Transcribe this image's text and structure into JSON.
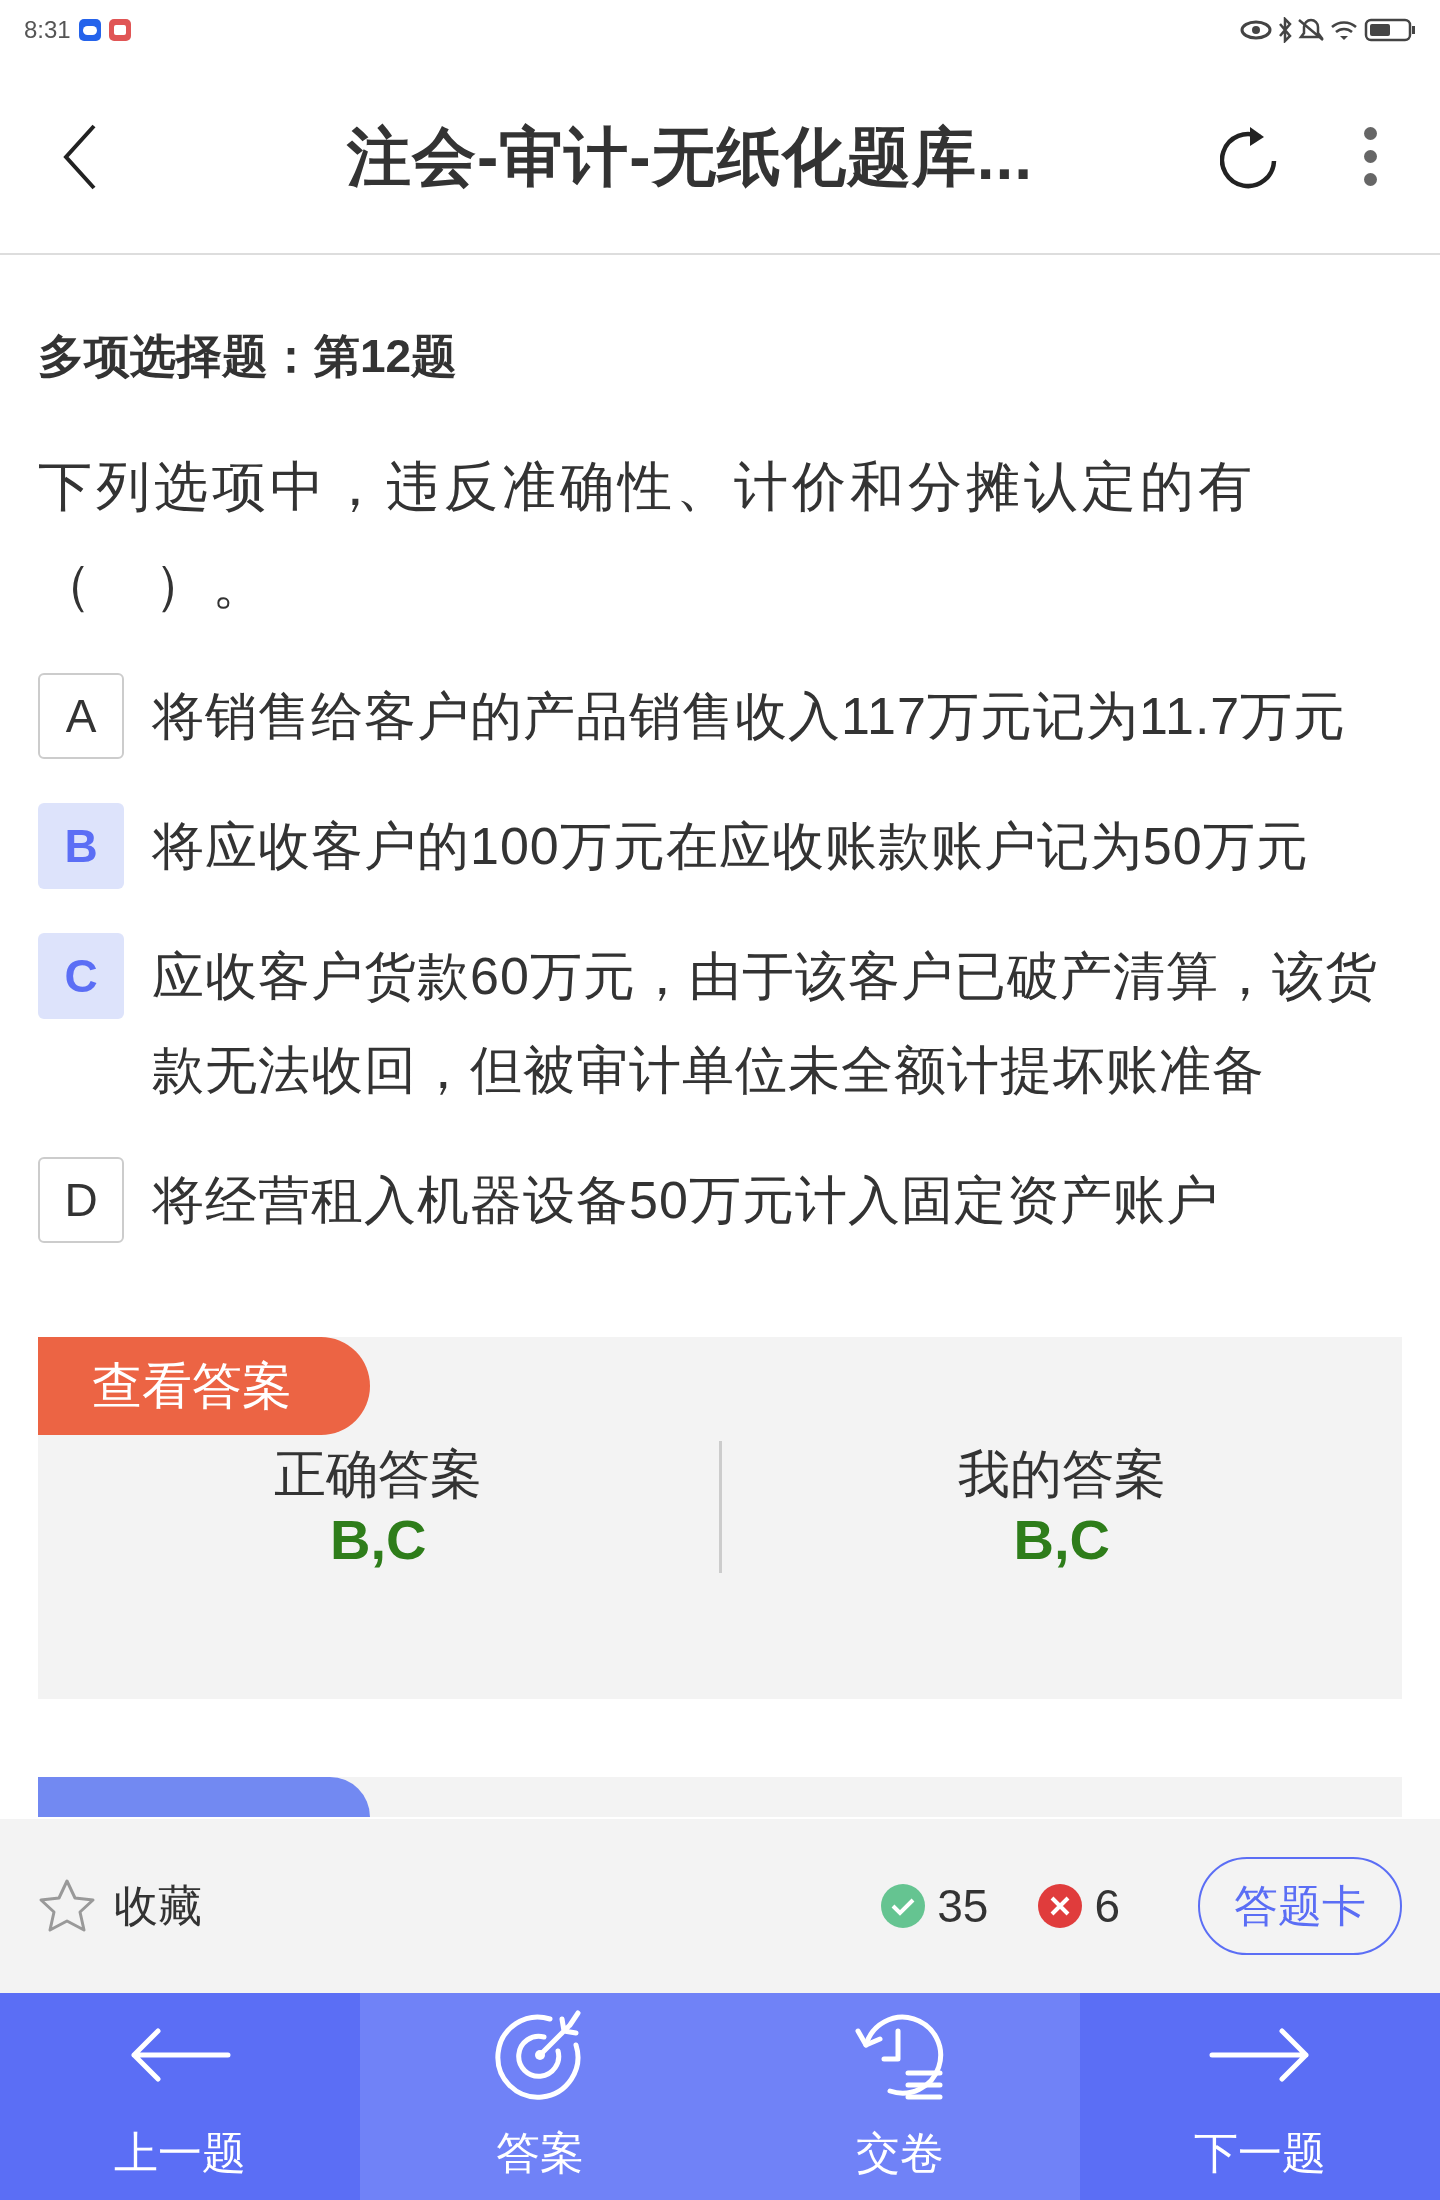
{
  "status_bar": {
    "time": "8:31"
  },
  "header": {
    "title": "注会-审计-无纸化题库..."
  },
  "question": {
    "type_label": "多项选择题：第12题",
    "text": "下列选项中，违反准确性、计价和分摊认定的有（　）。",
    "options": [
      {
        "letter": "A",
        "text": "将销售给客户的产品销售收入117万元记为11.7万元",
        "selected": false
      },
      {
        "letter": "B",
        "text": "将应收客户的100万元在应收账款账户记为50万元",
        "selected": true
      },
      {
        "letter": "C",
        "text": "应收客户货款60万元，由于该客户已破产清算，该货款无法收回，但被审计单位未全额计提坏账准备",
        "selected": true
      },
      {
        "letter": "D",
        "text": "将经营租入机器设备50万元计入固定资产账户",
        "selected": false
      }
    ]
  },
  "answer_panel": {
    "tag": "查看答案",
    "columns": [
      {
        "label": "正确答案",
        "value": "B,C"
      },
      {
        "label": "我的答案",
        "value": "B,C"
      }
    ]
  },
  "action_bar": {
    "favorite": {
      "label": "收藏",
      "on": false
    },
    "correct_count": "35",
    "wrong_count": "6",
    "card_button": "答题卡"
  },
  "nav": [
    {
      "kind": "prev",
      "label": "上一题",
      "selected": false
    },
    {
      "kind": "answer",
      "label": "答案",
      "selected": true
    },
    {
      "kind": "submit",
      "label": "交卷",
      "selected": true
    },
    {
      "kind": "next",
      "label": "下一题",
      "selected": false
    }
  ]
}
